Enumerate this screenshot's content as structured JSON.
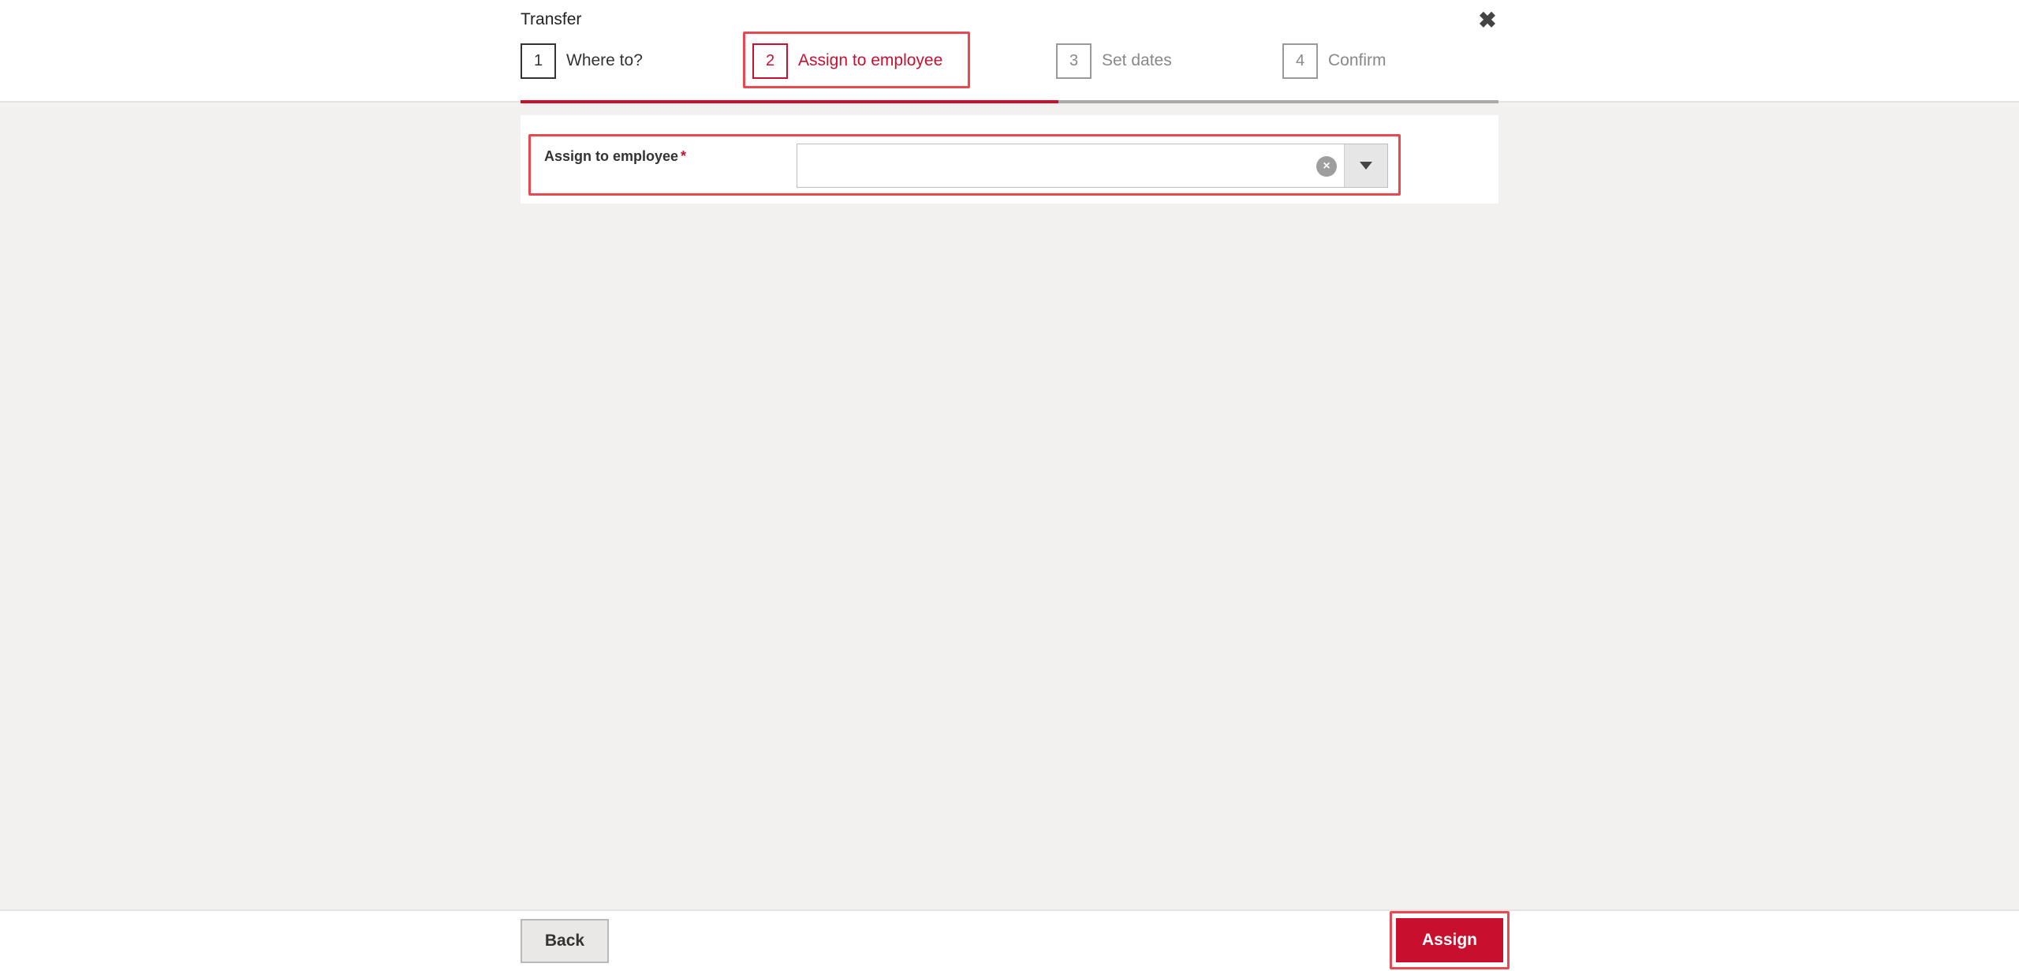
{
  "dialog": {
    "title": "Transfer",
    "close_icon": "close-icon"
  },
  "steps": [
    {
      "number": "1",
      "label": "Where to?",
      "state": "done"
    },
    {
      "number": "2",
      "label": "Assign to employee",
      "state": "active"
    },
    {
      "number": "3",
      "label": "Set dates",
      "state": "pending"
    },
    {
      "number": "4",
      "label": "Confirm",
      "state": "pending"
    }
  ],
  "progress": {
    "completed_fraction": 0.55
  },
  "form": {
    "assign_label": "Assign to employee",
    "required_mark": "*",
    "selected_value": "",
    "clear_icon": "clear-circle-icon",
    "dropdown_icon": "caret-down-icon"
  },
  "footer": {
    "back_label": "Back",
    "assign_label": "Assign"
  },
  "colors": {
    "accent": "#c8102e",
    "highlight": "#e8484f",
    "background": "#f2f1ef"
  }
}
